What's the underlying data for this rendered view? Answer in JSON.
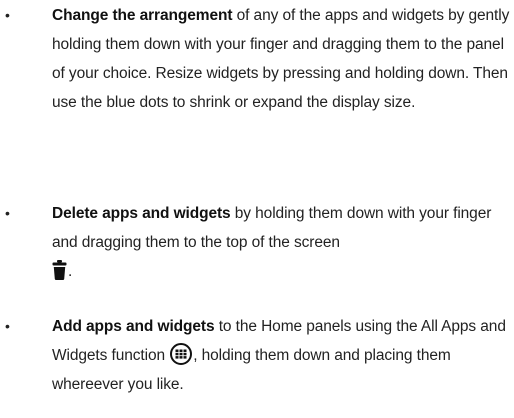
{
  "items": [
    {
      "bullet": "•",
      "bold": "Change the arrangement",
      "text": " of any of the apps and widgets by gently holding them down with your finger and dragging them to the panel of your choice. Resize widgets by pressing and holding down. Then use the blue dots to shrink or expand the display size."
    },
    {
      "bullet": "•",
      "bold": "Delete apps and widgets",
      "text": " by holding them down with your finger and dragging them to the top of the screen",
      "after_icon": ".",
      "icon": "trash-icon"
    },
    {
      "bullet": "•",
      "bold": "Add apps and widgets",
      "text": " to the Home panels using the All Apps and Widgets function",
      "after_icon": ", holding them down and placing them whereever you like.",
      "icon": "apps-grid-icon"
    }
  ]
}
